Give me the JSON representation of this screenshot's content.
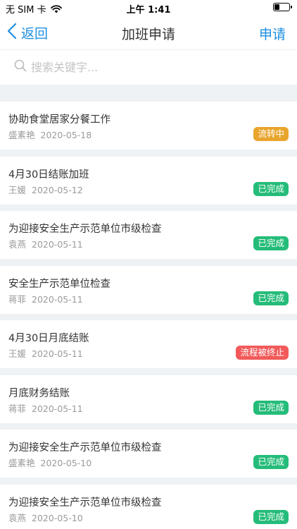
{
  "status_bar": {
    "carrier": "无 SIM 卡",
    "time": "上午 1:41",
    "battery_level": 0.35
  },
  "nav": {
    "back_label": "返回",
    "title": "加班申请",
    "action_label": "申请"
  },
  "search": {
    "placeholder": "搜索关键字..."
  },
  "colors": {
    "accent": "#1e8fe1",
    "status_in_progress": "#e9a42c",
    "status_done": "#25bc7a",
    "status_terminated": "#f25a5a"
  },
  "items": [
    {
      "title": "协助食堂居家分餐工作",
      "person": "盛素艳",
      "date": "2020-05-18",
      "status": "流转中",
      "status_type": "in_progress"
    },
    {
      "title": "4月30日结账加班",
      "person": "王媛",
      "date": "2020-05-12",
      "status": "已完成",
      "status_type": "done"
    },
    {
      "title": "为迎接安全生产示范单位市级检查",
      "person": "袁燕",
      "date": "2020-05-11",
      "status": "已完成",
      "status_type": "done"
    },
    {
      "title": "安全生产示范单位检查",
      "person": "蒋菲",
      "date": "2020-05-11",
      "status": "已完成",
      "status_type": "done"
    },
    {
      "title": "4月30日月底结账",
      "person": "王媛",
      "date": "2020-05-11",
      "status": "流程被终止",
      "status_type": "terminated"
    },
    {
      "title": "月底财务结账",
      "person": "蒋菲",
      "date": "2020-05-11",
      "status": "已完成",
      "status_type": "done"
    },
    {
      "title": "为迎接安全生产示范单位市级检查",
      "person": "盛素艳",
      "date": "2020-05-10",
      "status": "已完成",
      "status_type": "done"
    },
    {
      "title": "为迎接安全生产示范单位市级检查",
      "person": "袁燕",
      "date": "2020-05-10",
      "status": "已完成",
      "status_type": "done"
    }
  ]
}
